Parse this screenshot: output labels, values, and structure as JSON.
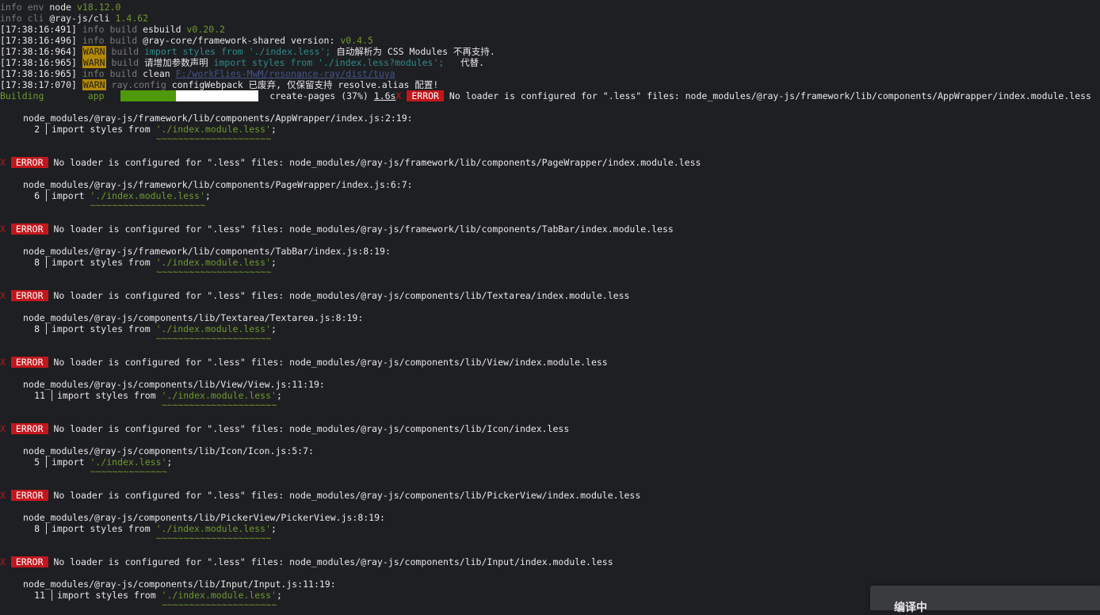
{
  "header_lines": [
    {
      "ts": "",
      "level": "info",
      "tag": "env",
      "text": "node",
      "extra": "v18.12.0"
    },
    {
      "ts": "",
      "level": "info",
      "tag": "cli",
      "text": "@ray-js/cli",
      "extra": "1.4.62"
    },
    {
      "ts": "[17:38:16:491]",
      "level": "info",
      "tag": "build",
      "text": "esbuild",
      "extra": "v0.20.2"
    },
    {
      "ts": "[17:38:16:496]",
      "level": "info",
      "tag": "build",
      "text": "@ray-core/framework-shared version:",
      "extra": "v0.4.5"
    }
  ],
  "warn1": {
    "ts": "[17:38:16:964]",
    "badge": "WARN",
    "tag": "build",
    "code": "import styles from './index.less';",
    "msg": " 自动解析为 CSS Modules 不再支持."
  },
  "warn2": {
    "ts": "[17:38:16:965]",
    "badge": "WARN",
    "tag": "build",
    "msg1": "请增加参数声明 ",
    "code": "import styles from './index.less?modules';",
    "msg2": "   代替."
  },
  "clean": {
    "ts": "[17:38:16:965]",
    "level": "info",
    "tag": "build",
    "text": "clean",
    "path": "F:/workFlies-MwM/resonance-ray/dist/tuya"
  },
  "warn3": {
    "ts": "[17:38:17:070]",
    "badge": "WARN",
    "tag": "ray.config",
    "msg": "configWebpack 已废弃, 仅保留支持 resolve.alias 配置!"
  },
  "progress": {
    "label": "Building",
    "app": "app",
    "percent": 37,
    "status": "create-pages (37%)",
    "time": "1.6s",
    "first_error": "No loader is configured for \".less\" files: node_modules/@ray-js/framework/lib/components/AppWrapper/index.module.less"
  },
  "error_badge": "ERROR",
  "error_mark": "X",
  "errors": [
    {
      "msg": "",
      "loc": "node_modules/@ray-js/framework/lib/components/AppWrapper/index.js:2:19:",
      "line": "2",
      "code": "import styles from ",
      "str": "'./index.module.less'",
      "end": ";",
      "squiggle": "~~~~~~~~~~~~~~~~~~~~~"
    },
    {
      "msg": "No loader is configured for \".less\" files: node_modules/@ray-js/framework/lib/components/PageWrapper/index.module.less",
      "loc": "node_modules/@ray-js/framework/lib/components/PageWrapper/index.js:6:7:",
      "line": "6",
      "code": "import ",
      "str": "'./index.module.less'",
      "end": ";",
      "squiggle": "~~~~~~~~~~~~~~~~~~~~~"
    },
    {
      "msg": "No loader is configured for \".less\" files: node_modules/@ray-js/framework/lib/components/TabBar/index.module.less",
      "loc": "node_modules/@ray-js/framework/lib/components/TabBar/index.js:8:19:",
      "line": "8",
      "code": "import styles from ",
      "str": "'./index.module.less'",
      "end": ";",
      "squiggle": "~~~~~~~~~~~~~~~~~~~~~"
    },
    {
      "msg": "No loader is configured for \".less\" files: node_modules/@ray-js/components/lib/Textarea/index.module.less",
      "loc": "node_modules/@ray-js/components/lib/Textarea/Textarea.js:8:19:",
      "line": "8",
      "code": "import styles from ",
      "str": "'./index.module.less'",
      "end": ";",
      "squiggle": "~~~~~~~~~~~~~~~~~~~~~"
    },
    {
      "msg": "No loader is configured for \".less\" files: node_modules/@ray-js/components/lib/View/index.module.less",
      "loc": "node_modules/@ray-js/components/lib/View/View.js:11:19:",
      "line": "11",
      "code": "import styles from ",
      "str": "'./index.module.less'",
      "end": ";",
      "squiggle": "~~~~~~~~~~~~~~~~~~~~~"
    },
    {
      "msg": "No loader is configured for \".less\" files: node_modules/@ray-js/components/lib/Icon/index.less",
      "loc": "node_modules/@ray-js/components/lib/Icon/Icon.js:5:7:",
      "line": "5",
      "code": "import ",
      "str": "'./index.less'",
      "end": ";",
      "squiggle": "~~~~~~~~~~~~~~"
    },
    {
      "msg": "No loader is configured for \".less\" files: node_modules/@ray-js/components/lib/PickerView/index.module.less",
      "loc": "node_modules/@ray-js/components/lib/PickerView/PickerView.js:8:19:",
      "line": "8",
      "code": "import styles from ",
      "str": "'./index.module.less'",
      "end": ";",
      "squiggle": "~~~~~~~~~~~~~~~~~~~~~"
    },
    {
      "msg": "No loader is configured for \".less\" files: node_modules/@ray-js/components/lib/Input/index.module.less",
      "loc": "node_modules/@ray-js/components/lib/Input/Input.js:11:19:",
      "line": "11",
      "code": "import styles from ",
      "str": "'./index.module.less'",
      "end": ";",
      "squiggle": "~~~~~~~~~~~~~~~~~~~~~"
    }
  ],
  "toast": {
    "label": "编译中"
  }
}
